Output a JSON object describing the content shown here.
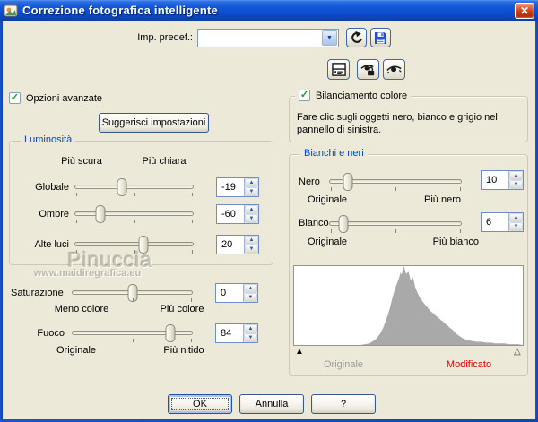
{
  "window": {
    "title": "Correzione fotografica intelligente"
  },
  "icons": {
    "check": "✓",
    "close": "✕",
    "dropdown": "▼",
    "spin_up": "▲",
    "spin_down": "▼",
    "tri_filled": "▲",
    "tri_outline": "△"
  },
  "preset": {
    "label": "Imp. predef.:",
    "value": ""
  },
  "advanced_checkbox": {
    "label": "Opzioni avanzate",
    "checked": true
  },
  "suggest_button": {
    "label": "Suggerisci impostazioni"
  },
  "luminosita": {
    "title": "Luminosità",
    "header_left": "Più scura",
    "header_right": "Più chiara",
    "rows": [
      {
        "label": "Globale",
        "value": "-19",
        "pos": 40
      },
      {
        "label": "Ombre",
        "value": "-60",
        "pos": 21
      },
      {
        "label": "Alte luci",
        "value": "20",
        "pos": 58
      }
    ]
  },
  "watermark": {
    "name": "Pinuccia",
    "url": "www.maidiregrafica.eu"
  },
  "saturazione": {
    "label": "Saturazione",
    "value": "0",
    "pos": 50,
    "left_label": "Meno colore",
    "right_label": "Più colore"
  },
  "fuoco": {
    "label": "Fuoco",
    "value": "84",
    "pos": 82,
    "left_label": "Originale",
    "right_label": "Più nitido"
  },
  "bilanciamento": {
    "label": "Bilanciamento colore",
    "checked": true,
    "description": "Fare clic sugli oggetti nero, bianco e grigio nel pannello di sinistra."
  },
  "bianchi_neri": {
    "title": "Bianchi e neri",
    "nero": {
      "label": "Nero",
      "value": "10",
      "pos": 14,
      "left_label": "Originale",
      "right_label": "Più nero"
    },
    "bianco": {
      "label": "Bianco",
      "value": "6",
      "pos": 10,
      "left_label": "Originale",
      "right_label": "Più bianco"
    },
    "histogram": {
      "fill_color": "#a9a9a9",
      "points": [
        [
          0,
          0
        ],
        [
          29,
          0
        ],
        [
          31,
          1
        ],
        [
          33,
          2
        ],
        [
          34,
          4
        ],
        [
          36,
          8
        ],
        [
          37,
          12
        ],
        [
          38,
          16
        ],
        [
          39,
          22
        ],
        [
          40,
          30
        ],
        [
          41,
          38
        ],
        [
          42,
          48
        ],
        [
          43,
          60
        ],
        [
          44,
          70
        ],
        [
          45,
          78
        ],
        [
          46,
          86
        ],
        [
          46.5,
          92
        ],
        [
          47,
          89
        ],
        [
          48,
          100
        ],
        [
          48.5,
          95
        ],
        [
          49,
          90
        ],
        [
          50,
          93
        ],
        [
          51,
          82
        ],
        [
          52,
          86
        ],
        [
          53,
          73
        ],
        [
          54,
          66
        ],
        [
          55,
          60
        ],
        [
          56,
          56
        ],
        [
          57,
          52
        ],
        [
          58,
          49
        ],
        [
          59,
          45
        ],
        [
          60,
          42
        ],
        [
          61,
          40
        ],
        [
          62,
          37
        ],
        [
          63,
          35
        ],
        [
          64,
          32
        ],
        [
          65,
          30
        ],
        [
          66,
          27
        ],
        [
          67,
          25
        ],
        [
          68,
          22
        ],
        [
          69,
          20
        ],
        [
          70,
          17
        ],
        [
          71,
          14
        ],
        [
          72,
          12
        ],
        [
          73,
          10
        ],
        [
          74,
          8
        ],
        [
          75,
          7
        ],
        [
          76,
          6
        ],
        [
          78,
          5
        ],
        [
          80,
          4
        ],
        [
          82,
          4
        ],
        [
          84,
          3
        ],
        [
          86,
          3
        ],
        [
          88,
          2
        ],
        [
          90,
          2
        ],
        [
          92,
          2
        ],
        [
          94,
          1
        ],
        [
          96,
          1
        ],
        [
          98,
          1
        ],
        [
          100,
          0
        ]
      ]
    },
    "original_label": "Originale",
    "modified_label": "Modificato"
  },
  "footer": {
    "ok": "OK",
    "cancel": "Annulla",
    "help": "?"
  }
}
